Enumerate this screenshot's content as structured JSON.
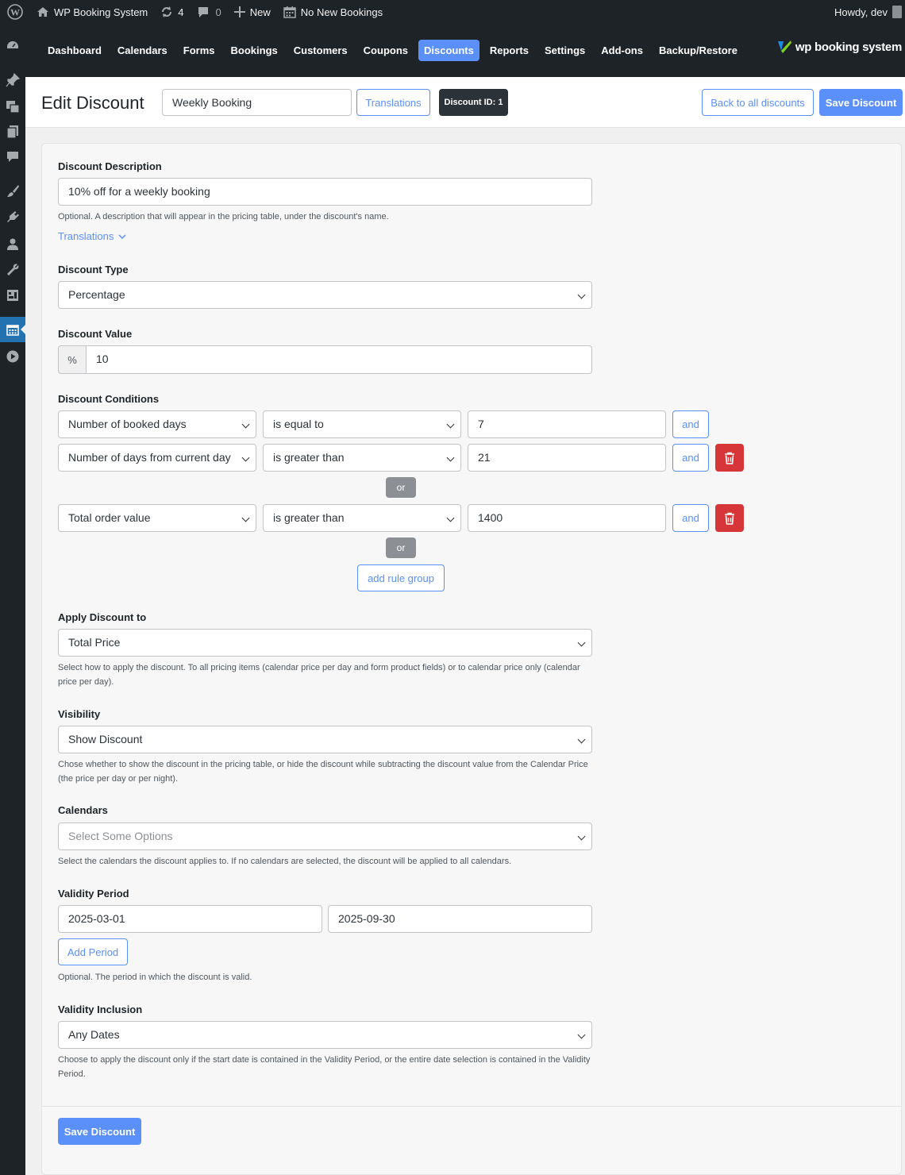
{
  "adminbar": {
    "site_name": "WP Booking System",
    "updates_count": "4",
    "comments_count": "0",
    "new_label": "New",
    "bookings_label": "No New Bookings",
    "greeting": "Howdy, dev"
  },
  "plugin_nav": {
    "items": [
      "Dashboard",
      "Calendars",
      "Forms",
      "Bookings",
      "Customers",
      "Coupons",
      "Discounts",
      "Reports",
      "Settings",
      "Add-ons",
      "Backup/Restore"
    ],
    "active": "Discounts",
    "logo_text": "wp booking system"
  },
  "header": {
    "title": "Edit Discount",
    "name_value": "Weekly Booking",
    "translations_label": "Translations",
    "discount_id_label": "Discount ID: 1",
    "back_label": "Back to all discounts",
    "save_label": "Save Discount"
  },
  "form": {
    "description": {
      "label": "Discount Description",
      "value": "10% off for a weekly booking",
      "help": "Optional. A description that will appear in the pricing table, under the discount's name.",
      "translations_link": "Translations"
    },
    "type": {
      "label": "Discount Type",
      "value": "Percentage"
    },
    "value": {
      "label": "Discount Value",
      "prefix": "%",
      "value": "10"
    },
    "conditions": {
      "label": "Discount Conditions",
      "rows": [
        {
          "field": "Number of booked days",
          "operator": "is equal to",
          "value": "7",
          "and_label": "and"
        },
        {
          "field": "Number of days from current day",
          "operator": "is greater than",
          "value": "21",
          "and_label": "and"
        },
        {
          "field": "Total order value",
          "operator": "is greater than",
          "value": "1400",
          "and_label": "and"
        }
      ],
      "or_label": "or",
      "add_rule_group_label": "add rule group"
    },
    "apply_to": {
      "label": "Apply Discount to",
      "value": "Total Price",
      "help": "Select how to apply the discount. To all pricing items (calendar price per day and form product fields) or to calendar price only (calendar price per day)."
    },
    "visibility": {
      "label": "Visibility",
      "value": "Show Discount",
      "help": "Chose whether to show the discount in the pricing table, or hide the discount while subtracting the discount value from the Calendar Price (the price per day or per night)."
    },
    "calendars": {
      "label": "Calendars",
      "placeholder": "Select Some Options",
      "help": "Select the calendars the discount applies to. If no calendars are selected, the discount will be applied to all calendars."
    },
    "validity_period": {
      "label": "Validity Period",
      "start": "2025-03-01",
      "end": "2025-09-30",
      "add_period_label": "Add Period",
      "help": "Optional. The period in which the discount is valid."
    },
    "validity_inclusion": {
      "label": "Validity Inclusion",
      "value": "Any Dates",
      "help": "Choose to apply the discount only if the start date is contained in the Validity Period, or the entire date selection is contained in the Validity Period."
    },
    "save_label": "Save Discount"
  },
  "colors": {
    "accent": "#5b8ff9",
    "danger": "#d63638",
    "admin_dark": "#1d2327",
    "menu_active": "#2271b1"
  }
}
